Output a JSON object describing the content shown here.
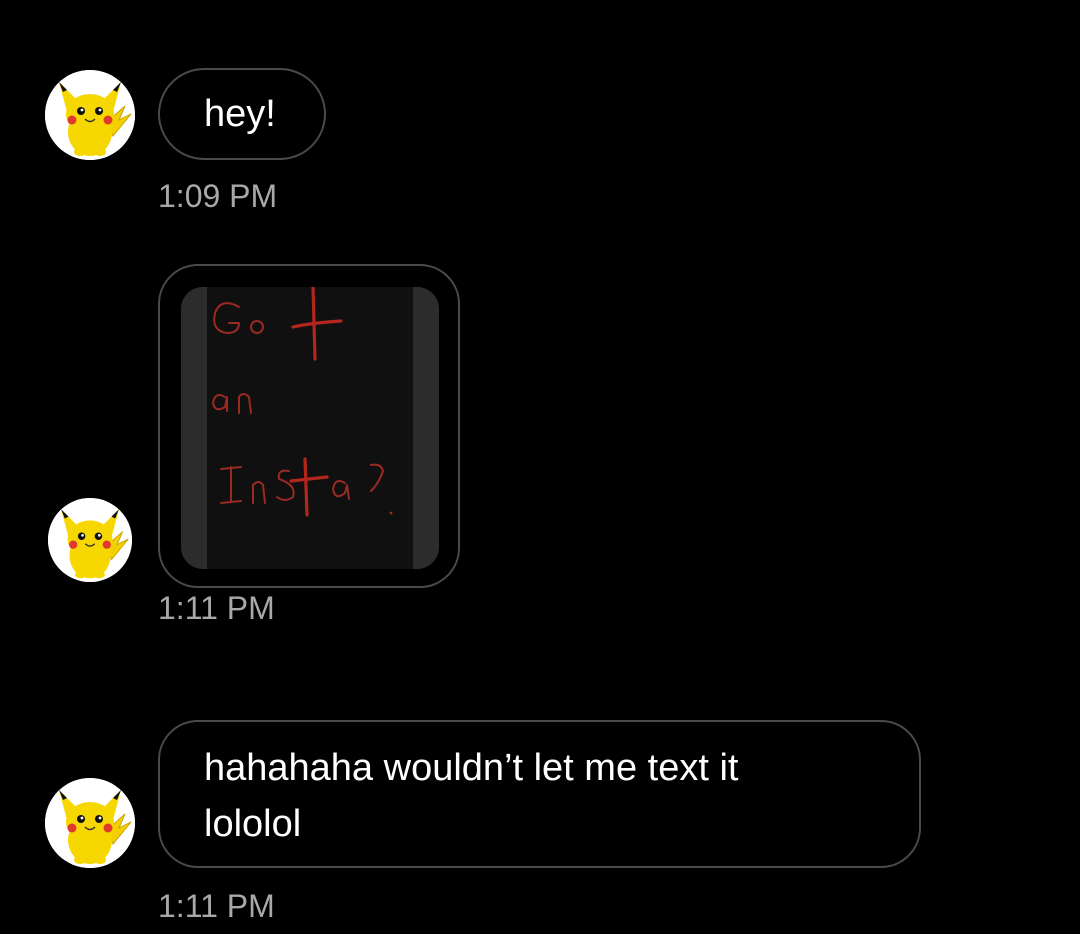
{
  "messages": [
    {
      "type": "text",
      "text": "hey!",
      "time": "1:09 PM"
    },
    {
      "type": "image",
      "image_text": "Got an Insta?",
      "time": "1:11 PM"
    },
    {
      "type": "text",
      "text": "hahahaha wouldn’t let me text it lololol",
      "time": "1:11 PM"
    }
  ],
  "avatar_icon": "pikachu-avatar-icon",
  "colors": {
    "background": "#000000",
    "bubble_border": "#4a4a4a",
    "timestamp": "#a8a8a8",
    "handwriting": "#b3261e"
  }
}
